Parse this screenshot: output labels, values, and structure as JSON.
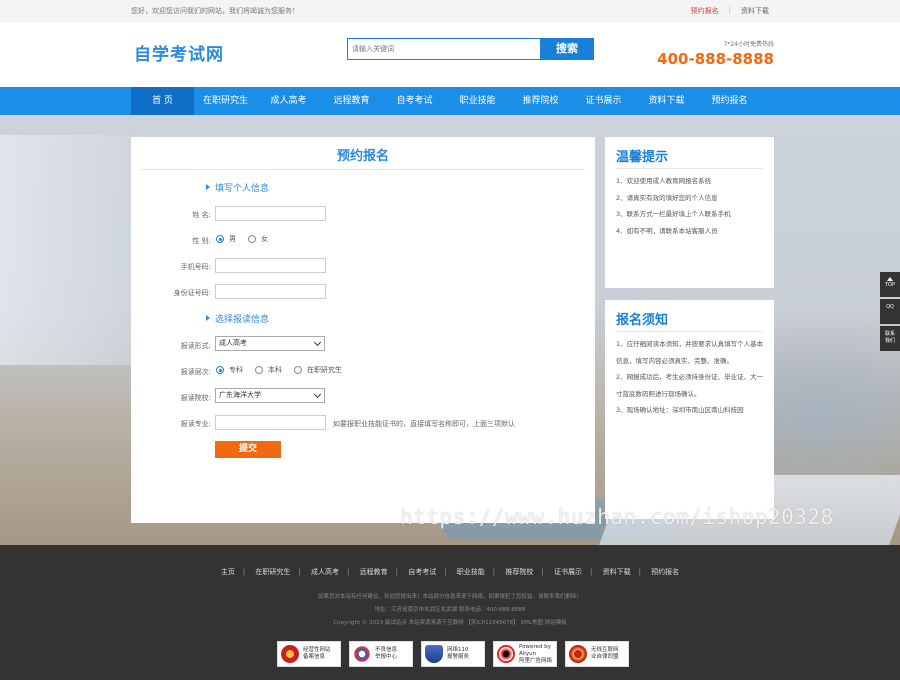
{
  "topbar": {
    "welcome": "您好，欢迎您访问我们的网站，我们将竭诚为您服务！",
    "link_signup": "预约报名",
    "separator": "|",
    "link_download": "资料下载"
  },
  "header": {
    "logo": "自学考试网",
    "search_placeholder": "请输入关键词",
    "search_button": "搜索",
    "hotline_label": "7*24小时免费热线",
    "hotline_number": "400-888-8888"
  },
  "nav": {
    "items": [
      {
        "label": "首 页"
      },
      {
        "label": "在职研究生"
      },
      {
        "label": "成人高考"
      },
      {
        "label": "远程教育"
      },
      {
        "label": "自考考试"
      },
      {
        "label": "职业技能"
      },
      {
        "label": "推荐院校"
      },
      {
        "label": "证书展示"
      },
      {
        "label": "资料下载"
      },
      {
        "label": "预约报名"
      }
    ]
  },
  "form": {
    "title": "预约报名",
    "section_personal": "填写个人信息",
    "name_label": "姓 名:",
    "gender_label": "性 别:",
    "gender_male": "男",
    "gender_female": "女",
    "phone_label": "手机号码:",
    "id_label": "身份证号码:",
    "section_study": "选择报读信息",
    "form_label": "报读形式:",
    "form_value": "成人高考",
    "level_label": "报读层次:",
    "level_options": [
      "专科",
      "本科",
      "在职研究生"
    ],
    "school_label": "报读院校:",
    "school_value": "广东海洋大学",
    "major_label": "报读专业:",
    "major_hint": "如要报职业技能证书的，直接填写名称即可，上面三项默认",
    "submit": "提交"
  },
  "tips": {
    "title": "温馨提示",
    "items": [
      "1、欢迎使用成人教育网报名系统",
      "2、请真实有效的填好您的个人信息",
      "3、联系方式一栏最好填上个人联系手机",
      "4、如有不明，请联系本站客服人员"
    ]
  },
  "notice": {
    "title": "报名须知",
    "items": [
      "1、应仔细阅读本须知，并按要求认真填写个人基本信息，填写内容必须真实、完整、准确。",
      "2、网报成功后，考生必须持身份证、毕业证、大一寸蓝底数码照进行现场确认。",
      "3、现场确认地址：深圳市南山区南山科技园"
    ]
  },
  "float_tools": {
    "top": "TOP",
    "qq": "QQ",
    "contact": "联系\n我们"
  },
  "watermark": "https://www.huzhan.com/ishop20328",
  "footer": {
    "nav": [
      "主页",
      "在职研究生",
      "成人高考",
      "远程教育",
      "自考考试",
      "职业技能",
      "推荐院校",
      "证书展示",
      "资料下载",
      "预约报名"
    ],
    "nav_sep": "|",
    "disclaimer": "如果您对本站有任何建议，欢迎您提出来！本站部分信息来源于网络，如果侵犯了您权益，请联系我们删除！",
    "address": "地址：江苏省南京市玄武区玄武湖    联系电话：400-888-8888",
    "copyright": "Copyright © 2023 最试站点 本站资源来源于互联网 【苏ICP12345678】 XML地图 网站模板",
    "badges": [
      {
        "line1": "经营性网站",
        "line2": "备案信息"
      },
      {
        "line1": "不良信息",
        "line2": "举报中心"
      },
      {
        "line1": "网络110",
        "line2": "报警服务"
      },
      {
        "line1": "Powered by Aliyun",
        "line2": "阿里广告网络"
      },
      {
        "line1": "无线互联网",
        "line2": "业自律同盟"
      }
    ]
  }
}
